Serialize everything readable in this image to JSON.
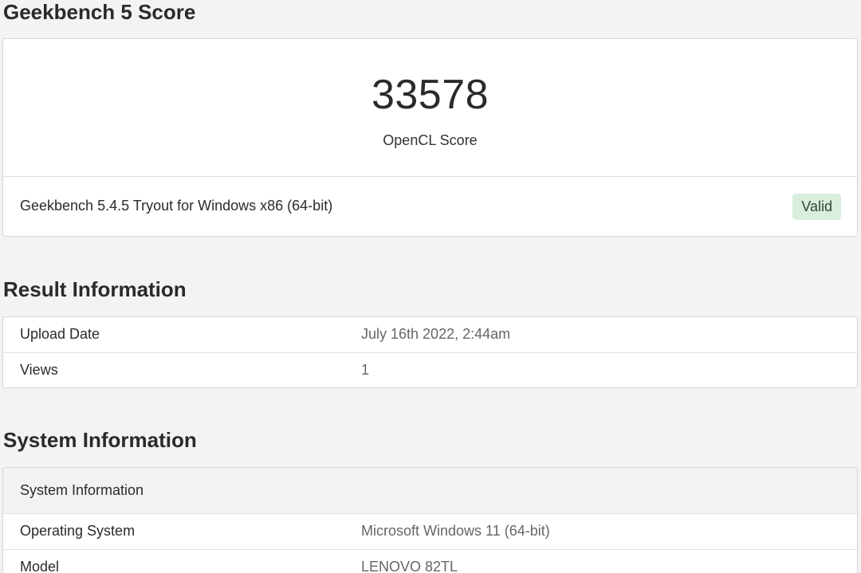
{
  "score_section": {
    "heading": "Geekbench 5 Score",
    "score": "33578",
    "score_label": "OpenCL Score",
    "version": "Geekbench 5.4.5 Tryout for Windows x86 (64-bit)",
    "badge": "Valid"
  },
  "result_section": {
    "heading": "Result Information",
    "rows": [
      {
        "label": "Upload Date",
        "value": "July 16th 2022, 2:44am"
      },
      {
        "label": "Views",
        "value": "1"
      }
    ]
  },
  "system_section": {
    "heading": "System Information",
    "table_header": "System Information",
    "rows": [
      {
        "label": "Operating System",
        "value": "Microsoft Windows 11 (64-bit)"
      },
      {
        "label": "Model",
        "value": "LENOVO 82TL"
      }
    ]
  },
  "colors": {
    "background": "#f3f3f3",
    "card": "#ffffff",
    "valid_badge_bg": "#d9eedd"
  }
}
